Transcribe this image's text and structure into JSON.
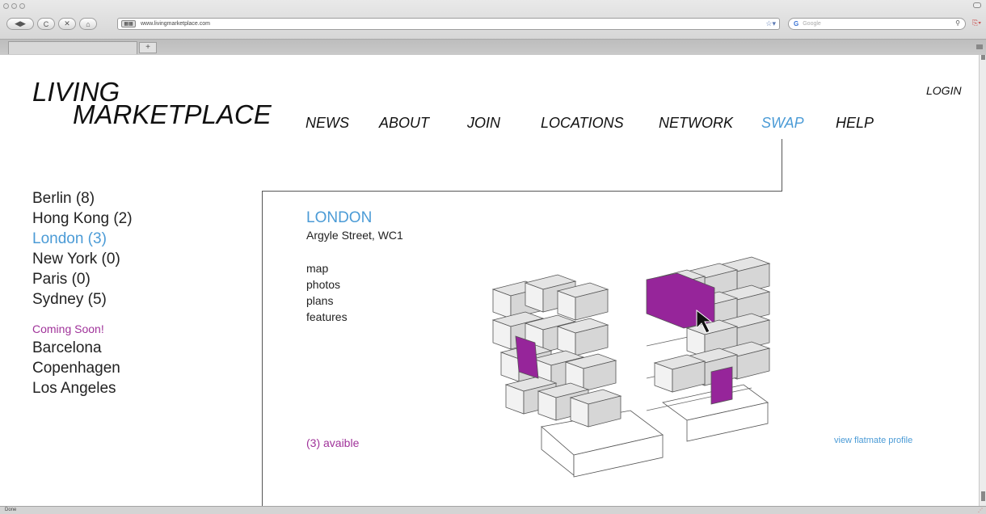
{
  "browser": {
    "url": "www.livingmarketplace.com",
    "search_placeholder": "Google",
    "new_tab_label": "+",
    "status": "Done",
    "back_label": "◀",
    "forward_label": "▶",
    "reload_label": "C",
    "stop_label": "✕",
    "home_label": "⌂",
    "favicon_label": "▦▦",
    "bookmark_star": "☆▾",
    "search_engine_label": "G",
    "search_icon_label": "⚲",
    "page_icon_label": "⎘▾",
    "grip_label": "⋰"
  },
  "site": {
    "logo_line1": "LIVING",
    "logo_line2": "MARKETPLACE",
    "login_label": "LOGIN"
  },
  "nav": {
    "items": [
      {
        "label": "NEWS"
      },
      {
        "label": "ABOUT"
      },
      {
        "label": "JOIN"
      },
      {
        "label": "LOCATIONS"
      },
      {
        "label": "NETWORK"
      },
      {
        "label": "SWAP"
      },
      {
        "label": "HELP"
      }
    ],
    "active": "SWAP"
  },
  "sidebar": {
    "cities": [
      {
        "label": "Berlin (8)"
      },
      {
        "label": "Hong Kong (2)"
      },
      {
        "label": "London (3)"
      },
      {
        "label": "New York (0)"
      },
      {
        "label": "Paris (0)"
      },
      {
        "label": "Sydney (5)"
      }
    ],
    "active_city": "London (3)",
    "coming_soon_label": "Coming Soon!",
    "coming_soon_cities": [
      {
        "label": "Barcelona"
      },
      {
        "label": "Copenhagen"
      },
      {
        "label": "Los Angeles"
      }
    ]
  },
  "location": {
    "title": "LONDON",
    "address": "Argyle Street, WC1",
    "links": [
      {
        "label": "map"
      },
      {
        "label": "photos"
      },
      {
        "label": "plans"
      },
      {
        "label": "features"
      }
    ],
    "available_label": "(3) avaible",
    "flatmate_link": "view flatmate profile"
  },
  "colors": {
    "accent_blue": "#4b9bd6",
    "accent_purple": "#a0339a",
    "text": "#111111"
  }
}
